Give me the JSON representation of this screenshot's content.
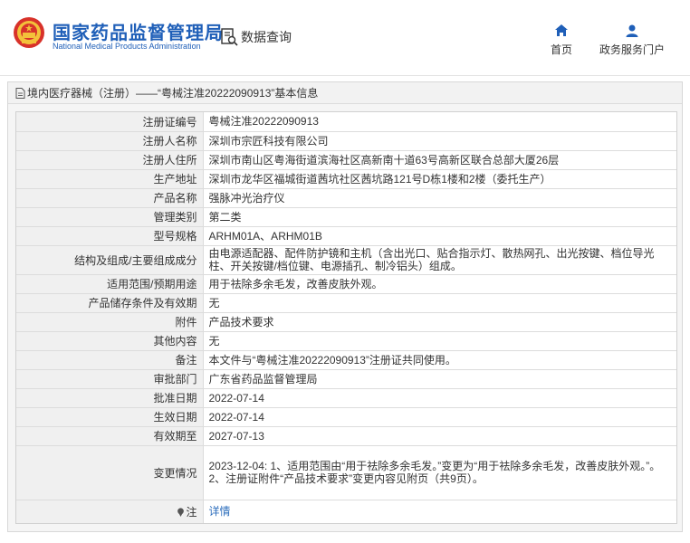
{
  "header": {
    "brand_title": "国家药品监督管理局",
    "brand_subtitle": "National Medical Products Administration",
    "data_query_label": "数据查询",
    "nav": [
      {
        "label": "首页",
        "icon": "home-icon"
      },
      {
        "label": "政务服务门户",
        "icon": "user-icon"
      }
    ],
    "brand_color": "#1f5fb8"
  },
  "breadcrumb": {
    "text": "境内医疗器械（注册）——“粤械注准20222090913”基本信息",
    "icon": "document-icon"
  },
  "details": [
    {
      "label": "注册证编号",
      "value": "粤械注准20222090913"
    },
    {
      "label": "注册人名称",
      "value": "深圳市宗匠科技有限公司"
    },
    {
      "label": "注册人住所",
      "value": "深圳市南山区粤海街道滨海社区高新南十道63号高新区联合总部大厦26层"
    },
    {
      "label": "生产地址",
      "value": "深圳市龙华区福城街道茜坑社区茜坑路121号D栋1楼和2楼（委托生产）"
    },
    {
      "label": "产品名称",
      "value": "强脉冲光治疗仪"
    },
    {
      "label": "管理类别",
      "value": "第二类"
    },
    {
      "label": "型号规格",
      "value": "ARHM01A、ARHM01B"
    },
    {
      "label": "结构及组成/主要组成成分",
      "value": "由电源适配器、配件防护镜和主机（含出光口、贴合指示灯、散热网孔、出光按键、档位导光柱、开关按键/档位键、电源插孔、制冷铝头）组成。"
    },
    {
      "label": "适用范围/预期用途",
      "value": "用于祛除多余毛发，改善皮肤外观。"
    },
    {
      "label": "产品储存条件及有效期",
      "value": "无"
    },
    {
      "label": "附件",
      "value": "产品技术要求"
    },
    {
      "label": "其他内容",
      "value": "无"
    },
    {
      "label": "备注",
      "value": "本文件与“粤械注准20222090913”注册证共同使用。"
    },
    {
      "label": "审批部门",
      "value": "广东省药品监督管理局"
    },
    {
      "label": "批准日期",
      "value": "2022-07-14"
    },
    {
      "label": "生效日期",
      "value": "2022-07-14"
    },
    {
      "label": "有效期至",
      "value": "2027-07-13"
    },
    {
      "label": "变更情况",
      "value_lines": [
        "2023-12-04: 1、适用范围由“用于祛除多余毛发。”变更为“用于祛除多余毛发，改善皮肤外观。”。",
        "2、注册证附件“产品技术要求”变更内容见附页（共9页）。"
      ]
    },
    {
      "label": "注",
      "value": "详情",
      "icon": "pin-icon"
    }
  ]
}
